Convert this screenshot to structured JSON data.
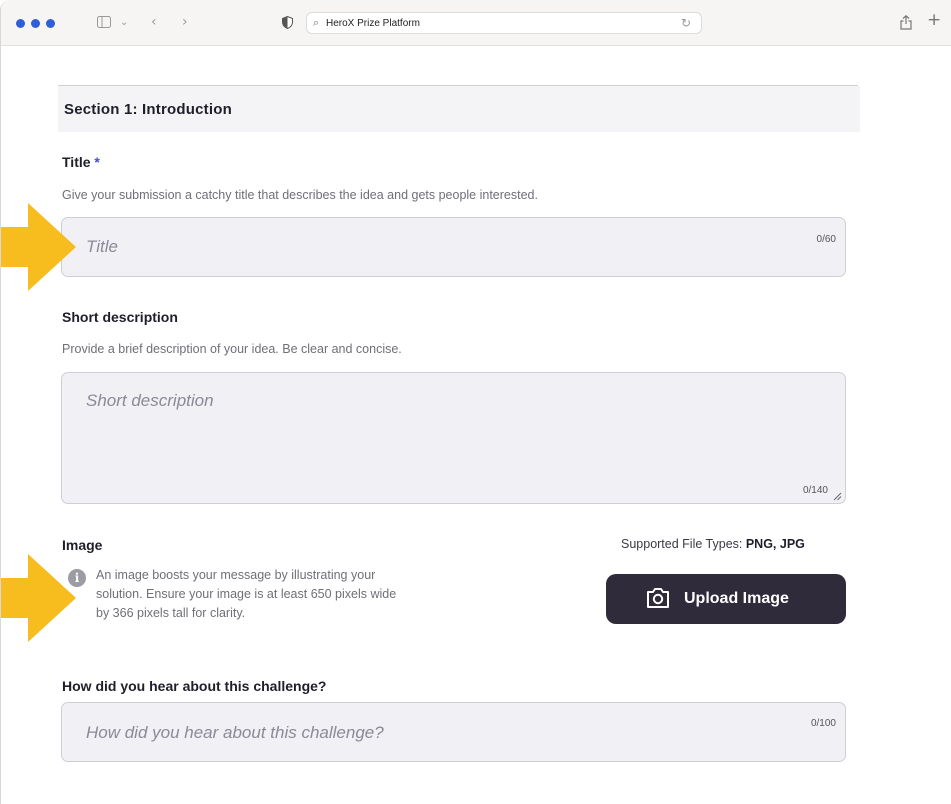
{
  "browser": {
    "address_text": "HeroX Prize Platform",
    "search_glyph": "magnifier-icon",
    "reload_glyph": "reload-icon"
  },
  "colors": {
    "accent_arrow": "#F7BC1E",
    "button_bg": "#2F2B3A",
    "required_star": "#4A4ACB",
    "field_bg": "#F1F0F5"
  },
  "section": {
    "title": "Section 1:  Introduction"
  },
  "title_field": {
    "label": "Title",
    "required_mark": "*",
    "help": "Give your submission a catchy title that describes the idea and gets people interested.",
    "placeholder": "Title",
    "counter": "0/60"
  },
  "short_desc": {
    "label": "Short description",
    "help": "Provide a brief description of your idea. Be clear and concise.",
    "placeholder": "Short description",
    "counter": "0/140"
  },
  "image": {
    "label": "Image",
    "supported_prefix": "Supported File Types: ",
    "supported_types": "PNG, JPG",
    "help_line1": "An image boosts your message by illustrating your",
    "help_line2": "solution. Ensure your image is at least 650 pixels wide",
    "help_line3": "by 366 pixels tall for clarity.",
    "info_glyph": "i",
    "upload_label": "Upload Image"
  },
  "hear": {
    "label": "How did you hear about this challenge?",
    "placeholder": "How did you hear about this challenge?",
    "counter": "0/100"
  }
}
